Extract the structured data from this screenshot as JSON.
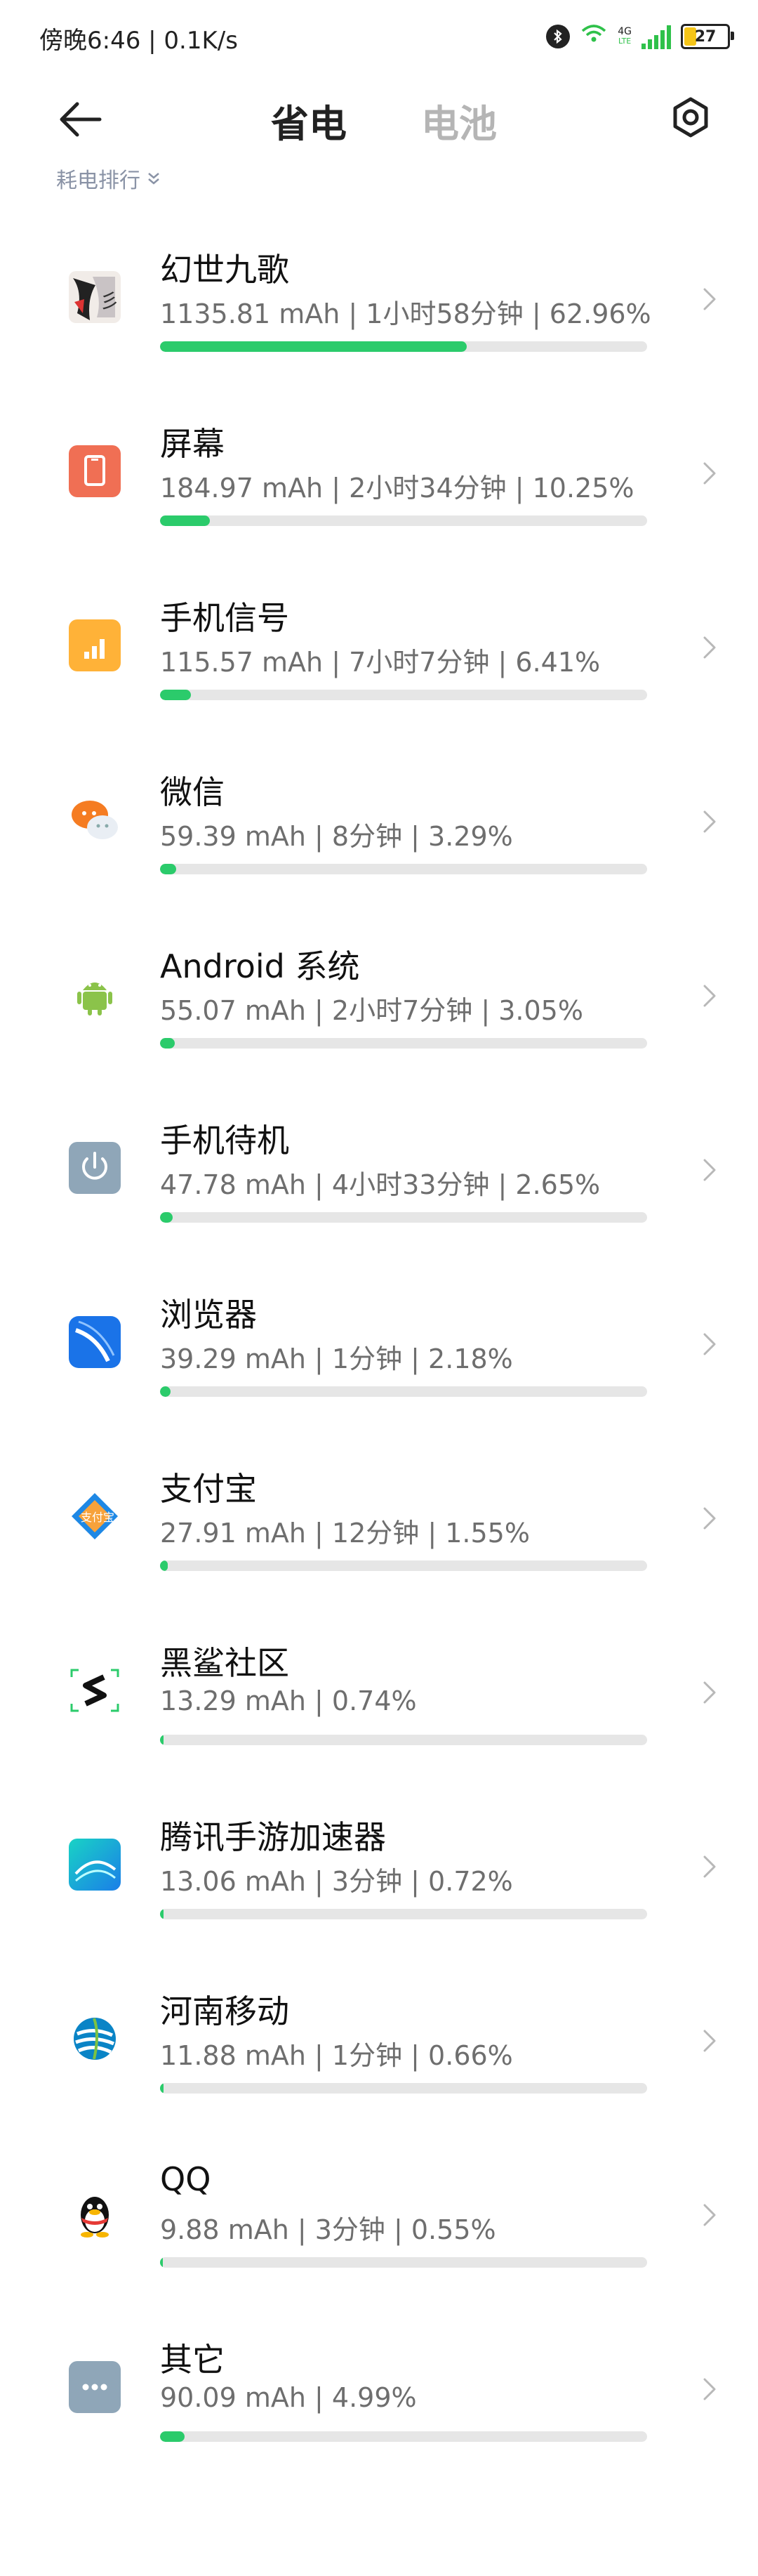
{
  "statusbar": {
    "time_speed": "傍晚6:46 | 0.1K/s",
    "network_label": "4G",
    "network_sub": "LTE",
    "battery_level": "27",
    "battery_fraction": 0.27
  },
  "header": {
    "tab_active": "省电",
    "tab_inactive": "电池"
  },
  "sort": {
    "label": "耗电排行"
  },
  "colors": {
    "progress_green": "#2bcb6b",
    "track_gray": "#e6e6e6"
  },
  "items": [
    {
      "name": "幻世九歌",
      "detail": "1135.81 mAh | 1小时58分钟 | 62.96%",
      "percent": 62.96,
      "icon": "game-icon"
    },
    {
      "name": "屏幕",
      "detail": "184.97 mAh | 2小时34分钟 | 10.25%",
      "percent": 10.25,
      "icon": "screen-icon"
    },
    {
      "name": "手机信号",
      "detail": "115.57 mAh | 7小时7分钟 | 6.41%",
      "percent": 6.41,
      "icon": "signal-icon"
    },
    {
      "name": "微信",
      "detail": "59.39 mAh | 8分钟 | 3.29%",
      "percent": 3.29,
      "icon": "wechat-icon"
    },
    {
      "name": "Android 系统",
      "detail": "55.07 mAh | 2小时7分钟 | 3.05%",
      "percent": 3.05,
      "icon": "android-icon"
    },
    {
      "name": "手机待机",
      "detail": "47.78 mAh | 4小时33分钟 | 2.65%",
      "percent": 2.65,
      "icon": "power-icon"
    },
    {
      "name": "浏览器",
      "detail": "39.29 mAh | 1分钟 | 2.18%",
      "percent": 2.18,
      "icon": "browser-icon"
    },
    {
      "name": "支付宝",
      "detail": "27.91 mAh | 12分钟 | 1.55%",
      "percent": 1.55,
      "icon": "alipay-icon"
    },
    {
      "name": "黑鲨社区",
      "detail": "13.29 mAh | 0.74%",
      "percent": 0.74,
      "icon": "blackshark-icon"
    },
    {
      "name": "腾讯手游加速器",
      "detail": "13.06 mAh | 3分钟 | 0.72%",
      "percent": 0.72,
      "icon": "accelerator-icon"
    },
    {
      "name": "河南移动",
      "detail": "11.88 mAh | 1分钟 | 0.66%",
      "percent": 0.66,
      "icon": "china-mobile-icon"
    },
    {
      "name": "QQ",
      "detail": "9.88 mAh | 3分钟 | 0.55%",
      "percent": 0.55,
      "icon": "qq-icon"
    },
    {
      "name": "其它",
      "detail": "90.09 mAh | 4.99%",
      "percent": 4.99,
      "icon": "other-icon"
    }
  ]
}
